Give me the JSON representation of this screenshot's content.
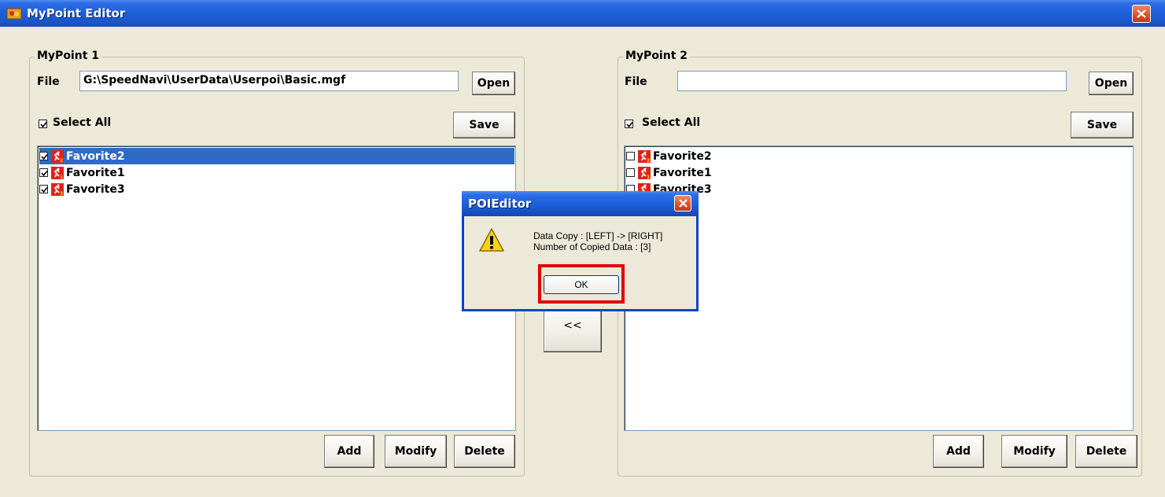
{
  "window": {
    "title": "MyPoint Editor"
  },
  "left": {
    "group_title": "MyPoint 1",
    "file_label": "File",
    "file_value": "G:\\SpeedNavi\\UserData\\Userpoi\\Basic.mgf",
    "open_label": "Open",
    "select_all_label": "Select All",
    "select_all_checked": true,
    "save_label": "Save",
    "items": [
      {
        "label": "Favorite2",
        "checked": true,
        "selected": true,
        "badge": "2"
      },
      {
        "label": "Favorite1",
        "checked": true,
        "selected": false,
        "badge": "1"
      },
      {
        "label": "Favorite3",
        "checked": true,
        "selected": false,
        "badge": "3"
      }
    ],
    "add_label": "Add",
    "modify_label": "Modify",
    "delete_label": "Delete"
  },
  "middle": {
    "copy_left_label": "<<"
  },
  "right": {
    "group_title": "MyPoint 2",
    "file_label": "File",
    "file_value": "",
    "open_label": "Open",
    "select_all_label": "Select All",
    "select_all_checked": true,
    "save_label": "Save",
    "items": [
      {
        "label": "Favorite2",
        "checked": false,
        "badge": "2"
      },
      {
        "label": "Favorite1",
        "checked": false,
        "badge": "1"
      },
      {
        "label": "Favorite3",
        "checked": false,
        "badge": "3"
      }
    ],
    "add_label": "Add",
    "modify_label": "Modify",
    "delete_label": "Delete"
  },
  "dialog": {
    "title": "POIEditor",
    "line1": "Data Copy : [LEFT] -> [RIGHT]",
    "line2": "Number of Copied Data : [3]",
    "ok_label": "OK",
    "icon": "warning-icon"
  },
  "colors": {
    "selection": "#316ac5",
    "highlight": "#e00000",
    "titlebar": "#1c5fd9"
  }
}
